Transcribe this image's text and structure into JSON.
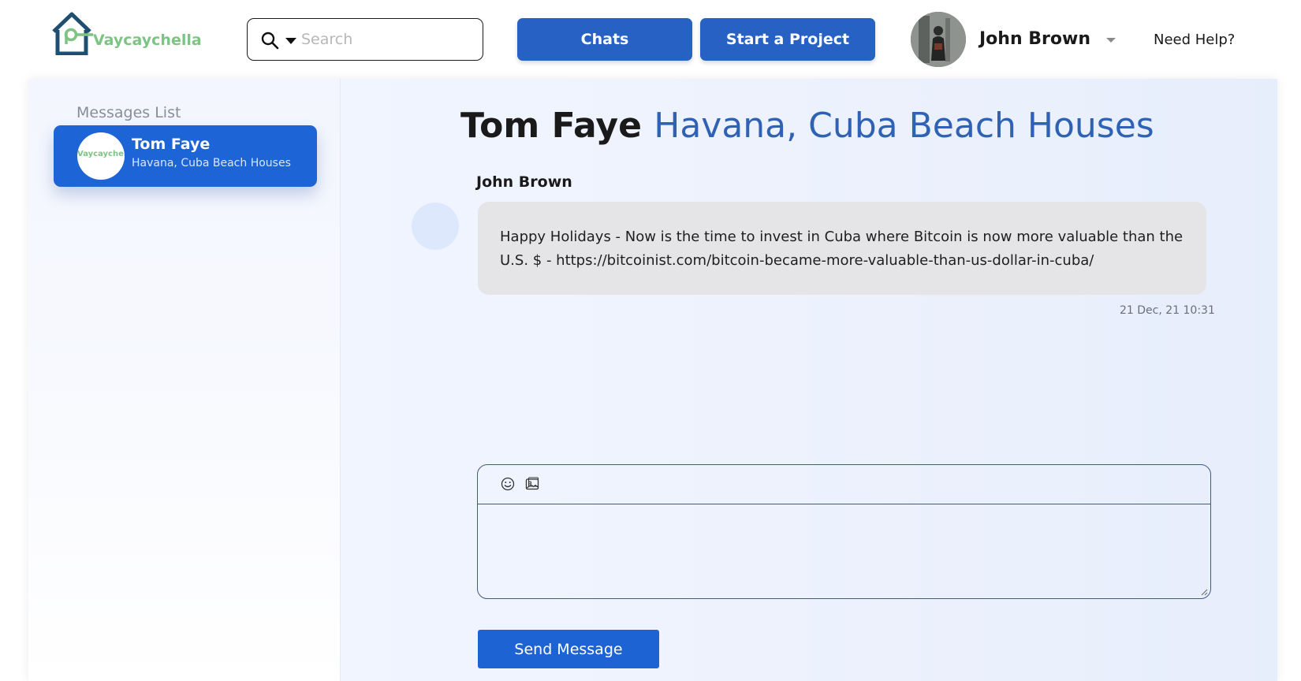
{
  "brand": {
    "name": "Vaycaychella",
    "color": "#7dc383",
    "icon": "house-key-icon"
  },
  "search": {
    "placeholder": "Search",
    "icon": "search-icon"
  },
  "nav": {
    "chats_label": "Chats",
    "project_label": "Start a Project",
    "button_color": "#2761c3"
  },
  "user": {
    "name": "John Brown",
    "help_label": "Need Help?"
  },
  "sidebar": {
    "title": "Messages List",
    "contacts": [
      {
        "name": "Tom Faye",
        "subtitle": "Havana, Cuba Beach Houses",
        "avatar_logo": "Vaycaychella",
        "active": true
      }
    ]
  },
  "chat": {
    "contact_name": "Tom Faye",
    "location": "Havana, Cuba Beach Houses",
    "messages": [
      {
        "sender": "John Brown",
        "text": "Happy Holidays - Now is the time to invest in Cuba where Bitcoin is now more valuable than the U.S. $ - https://bitcoinist.com/bitcoin-became-more-valuable-than-us-dollar-in-cuba/",
        "timestamp": "21 Dec, 21 10:31"
      }
    ],
    "composer": {
      "emoji_icon": "emoji-icon",
      "image_icon": "image-icon",
      "value": ""
    },
    "send_label": "Send Message",
    "accent_color": "#1d63d4"
  }
}
